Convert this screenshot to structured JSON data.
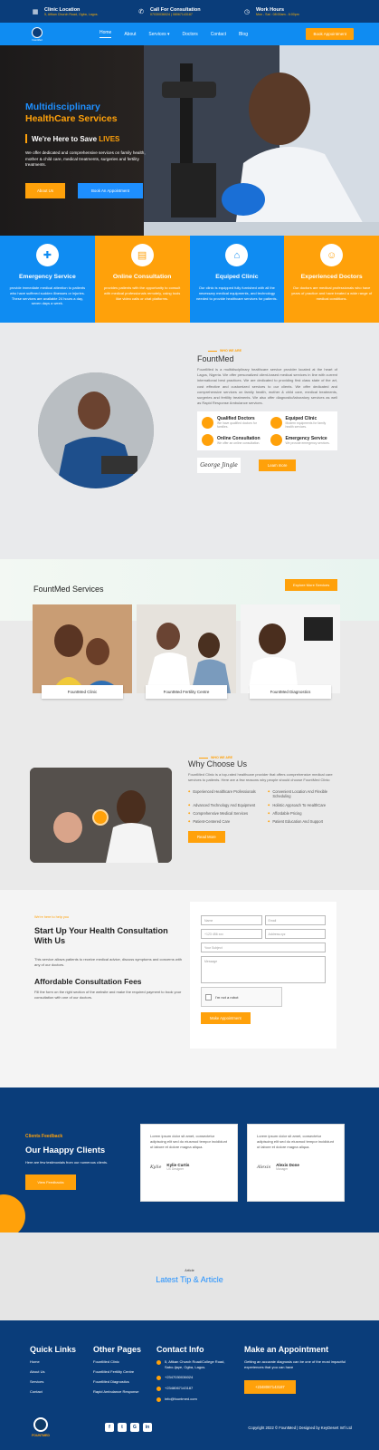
{
  "topbar": {
    "items": [
      {
        "icon": "building-icon",
        "title": "Clinic Location",
        "sub": "5, Afikan Church Road, Ogba, Lagos."
      },
      {
        "icon": "phone-icon",
        "title": "Call For Consultation",
        "sub": "07030036024 | 08067143187"
      },
      {
        "icon": "clock-icon",
        "title": "Work Hours",
        "sub": "Mon - Sat : 08:00am - 6:00pm"
      }
    ]
  },
  "nav": {
    "logo_text": "FountMed",
    "items": [
      "Home",
      "About",
      "Services ▾",
      "Doctors",
      "Contact",
      "Blog"
    ],
    "appointment": "Book Appointment"
  },
  "hero": {
    "line1": "Multidisciplinary",
    "line2": "HealthCare Services",
    "tagline": "We're Here to Save",
    "tagline_hl": "LIVES",
    "para": "We offer dedicated and comprehensive services on family health, mother & child care, medical treatments, surgeries and fertility treatments.",
    "btn1": "About Us",
    "btn2": "Book An Appointment"
  },
  "features": [
    {
      "icon": "ambulance-icon",
      "title": "Emergency Service",
      "desc": "provide immediate medical attention to patients who have suffered sudden illnesses or injuries. These services are available 24 hours a day, seven days a week."
    },
    {
      "icon": "calendar-icon",
      "title": "Online Consultation",
      "desc": "provides patients with the opportunity to consult with medical professionals remotely, using tools like video calls or chat platforms."
    },
    {
      "icon": "clinic-icon",
      "title": "Equiped Clinic",
      "desc": "Our clinic is equipped fully furnished with all the necessary medical equipments, and technology needed to provide healthcare services for patients."
    },
    {
      "icon": "doctor-icon",
      "title": "Experienced Doctors",
      "desc": "Our doctors are medical professionals who have years of practice and have treated a wide range of medical conditions."
    }
  ],
  "about": {
    "small": "WHO WE ARE",
    "title": "FountMed",
    "para": "FountMed is a multidisciplinary healthcare service provider located at the heart of Lagos, Nigeria. We offer personalized client-based medical services in line with current international best practices. We are dedicated to providing first class state of the art, cost effective and customized services to our clients. We offer dedicated and comprehensive services on family health, mother & child care, medical treatments, surgeries and fertility treatments. We also offer diagnostic/laboratory services as well as Rapid Response Ambulance services.",
    "qualities": [
      {
        "title": "Qualified Doctors",
        "desc": "We have qualified doctors for families."
      },
      {
        "title": "Equiped Clinic",
        "desc": "Modern equipments for family health services."
      },
      {
        "title": "Online Consultation",
        "desc": "We offer an online consultation."
      },
      {
        "title": "Emergency Service",
        "desc": "We provide emergency services."
      }
    ],
    "signature": "George Jingle",
    "btn": "Learn more"
  },
  "services": {
    "title": "FountMed Services",
    "btn": "Explore More Services",
    "cards": [
      "FountMed Clinic",
      "FountMed Fertility Centre",
      "FountMed Diagnostics"
    ]
  },
  "why": {
    "small": "WHO WE ARE",
    "title": "Why Choose Us",
    "para": "FountMed Clinic is a top-rated healthcare provider that offers comprehensive medical care services to patients. Here are a few reasons why people should choose FountMed Clinic:",
    "items": [
      "Experienced Healthcare Professionals",
      "Convenient Location And Flexible Scheduling",
      "Advanced Technology And Equipment",
      "Holistic Approach To HealthCare",
      "Comprehensive Medical Services",
      "Affordable Pricing",
      "Patient-Centered Care",
      "Patient Education And Support"
    ],
    "btn": "Read More"
  },
  "consult": {
    "small": "We're here to help you",
    "title": "Start Up Your Health Consultation With Us",
    "para": "This service allows patients to receive medical advice, discuss symptoms and concerns with any of our doctors.",
    "title2": "Affordable Consultation Fees",
    "para2": "Fill the form on the right section of the website and make the required payment to book your consultation with one of our doctors.",
    "form": {
      "name": "Name",
      "email": "Email",
      "phone": "+123 456 xxx",
      "address": "Address.xyz",
      "subject": "Your Subject",
      "message": "Message",
      "captcha": "I'm not a robot",
      "submit": "Make Appointment"
    }
  },
  "testimonials": {
    "small": "Clients Feedback",
    "title": "Our Haappy Clients",
    "para": "Here are few testimonials from our numerous clients.",
    "btn": "View Feedbacks",
    "cards": [
      {
        "quote": "Lorem ipsum dolor sit amet, consectetur adipiscing elit sed do eiusmod tempor incididunt ut labore et dolore magna aliqua.",
        "sig": "Kylie",
        "name": "Kylie Curtis",
        "role": "UX Designer"
      },
      {
        "quote": "Lorem ipsum dolor sit amet, consectetur adipiscing elit sed do eiusmod tempor incididunt ut labore et dolore magna aliqua.",
        "sig": "Alexis",
        "name": "Alexis Done",
        "role": "Manager"
      }
    ]
  },
  "tips": {
    "small": "Article",
    "title": "Latest Tip & Article"
  },
  "footer": {
    "quick_title": "Quick Links",
    "quick": [
      "Home",
      "About Us",
      "Services",
      "Contact"
    ],
    "other_title": "Other Pages",
    "other": [
      "FountMed Clinic",
      "FountMed Fertility Centre",
      "FountMed Diagnostics",
      "Rapid Ambulance Response"
    ],
    "contact_title": "Contact Info",
    "contact": [
      "5, Afikan Church Road/College Road, Sabo-Ijaye, Ogba, Lagos.",
      "+2347030036024",
      "+2348067143187",
      "info@fountmed.com"
    ],
    "appt_title": "Make an Appointment",
    "appt_para": "Getting an accurate diagnosis can be one of the most impactful experiences that you can have",
    "call": "+2348067143187",
    "logo_text": "FOUNTMED",
    "social": [
      "f",
      "t",
      "G",
      "in"
    ],
    "copyright": "Copyright 2022 © FountMed | Designed by KeyDesert Int'l Ltd"
  }
}
